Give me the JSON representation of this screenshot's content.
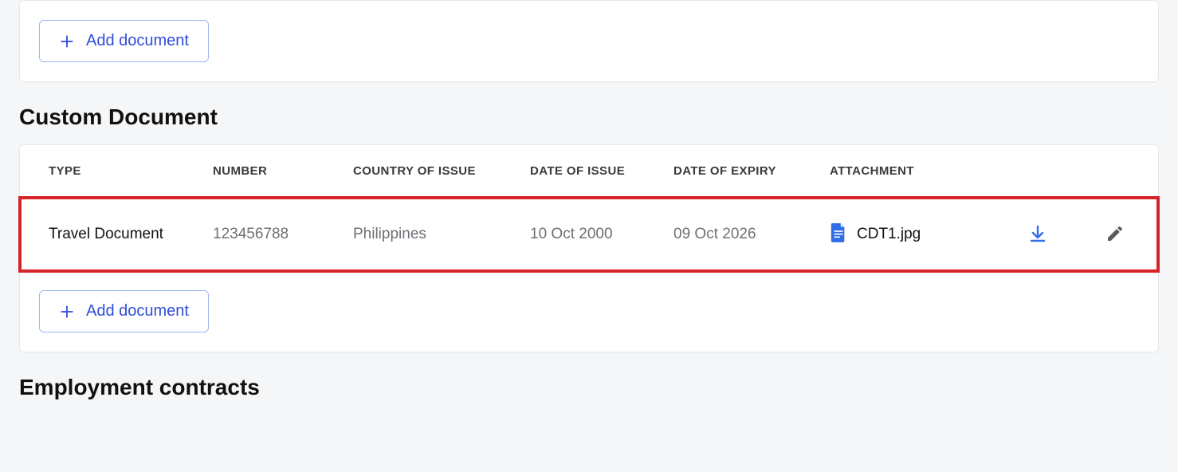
{
  "buttons": {
    "add_document": "Add document"
  },
  "sections": {
    "custom_document": {
      "title": "Custom Document",
      "table": {
        "headers": {
          "type": "TYPE",
          "number": "NUMBER",
          "country_of_issue": "COUNTRY OF ISSUE",
          "date_of_issue": "DATE OF ISSUE",
          "date_of_expiry": "DATE OF EXPIRY",
          "attachment": "ATTACHMENT"
        },
        "rows": [
          {
            "type": "Travel Document",
            "number": "123456788",
            "country": "Philippines",
            "date_of_issue": "10 Oct 2000",
            "date_of_expiry": "09 Oct 2026",
            "attachment": "CDT1.jpg"
          }
        ]
      }
    },
    "employment_contracts": {
      "title": "Employment contracts"
    }
  },
  "icons": {
    "plus": "plus-icon",
    "file": "file-icon",
    "download": "download-icon",
    "edit": "pencil-icon"
  },
  "colors": {
    "accent": "#2f4ed8",
    "highlight_border": "#d6232a"
  }
}
